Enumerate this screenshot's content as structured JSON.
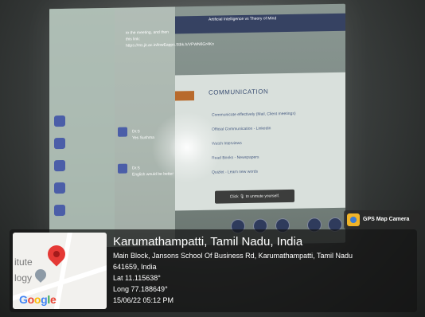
{
  "screen": {
    "meeting_title": "Artificial Intelligence vs Theory of Mind",
    "chat_message": "to the meeting, and then this link: https://ms.jit.ac.in/lowEapps.Stbk.h/VPWN6Gr4Ko",
    "slide_title": "COMMUNICATION",
    "slide_bullets": [
      "Communicate effectively (Mail, Client meetings)",
      "Official Communication - Linkedin",
      "Watch Interviews",
      "Read Books - Newspapers",
      "Quizlet - Learn new words"
    ],
    "unmute_prompt": "Click 🎙 to unmute yourself.",
    "chat_rows": [
      {
        "name": "Dr.S",
        "text": "Yes Sushma"
      },
      {
        "name": "Dr.S",
        "text": "English would be better"
      }
    ]
  },
  "overlay": {
    "badge_label": "GPS Map Camera",
    "map_text_1": "itute",
    "map_text_2": "logy",
    "google_letters": [
      "G",
      "o",
      "o",
      "g",
      "l",
      "e"
    ],
    "location_title": "Karumathampatti, Tamil Nadu, India",
    "address_line_1": "Main Block, Jansons School Of Business Rd, Karumathampatti, Tamil Nadu",
    "address_line_2": "641659, India",
    "latitude": "Lat 11.115638°",
    "longitude": "Long 77.188649°",
    "timestamp": "15/06/22 05:12 PM"
  }
}
